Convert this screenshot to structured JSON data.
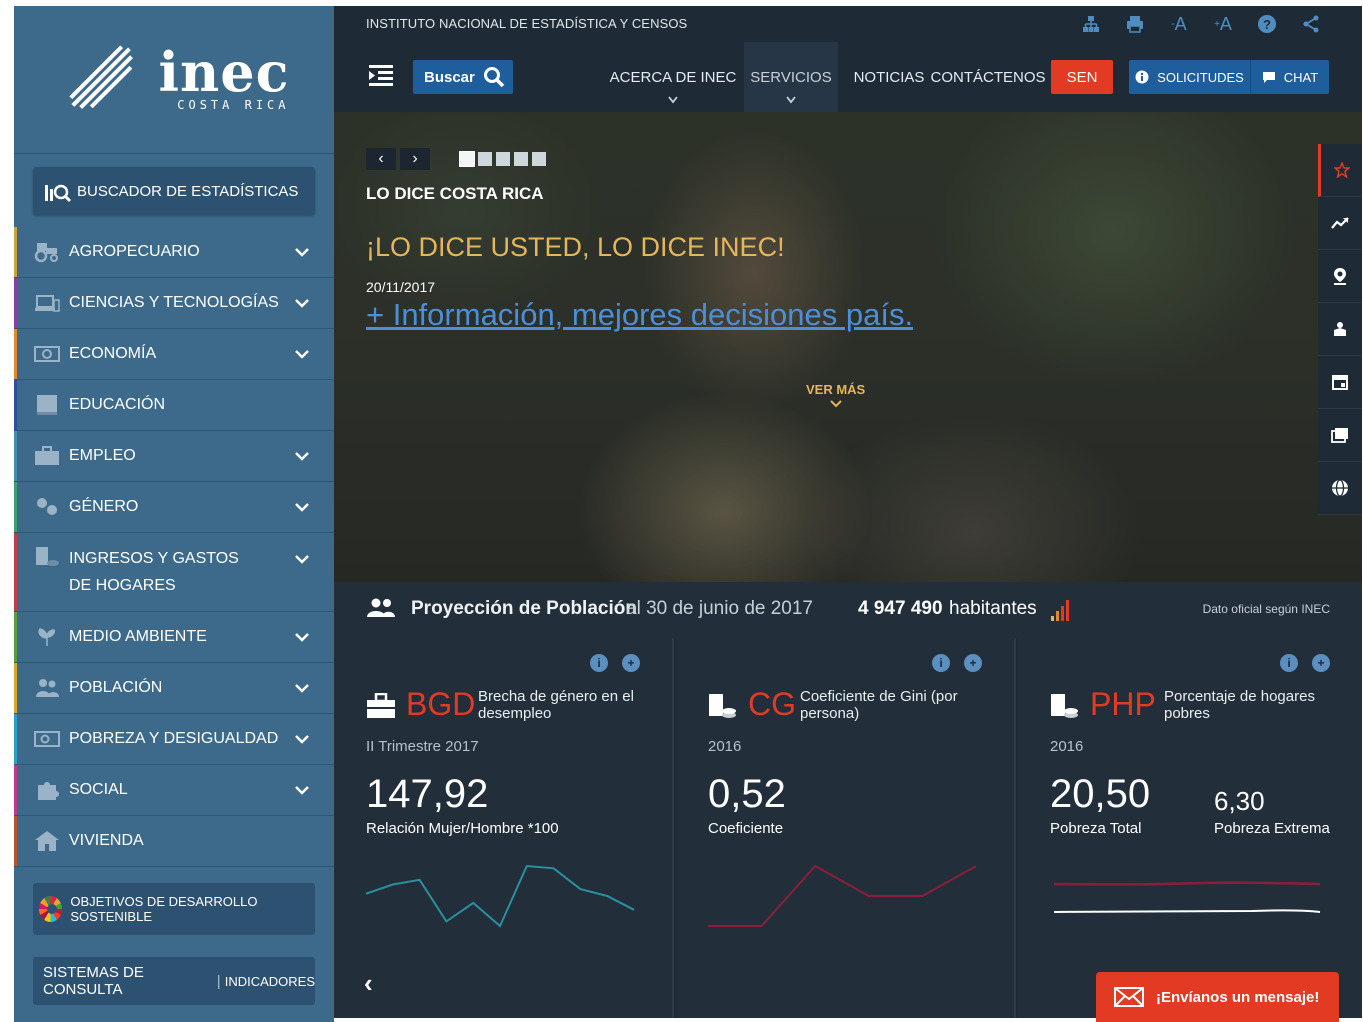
{
  "brand": {
    "logo_text": "inec",
    "logo_sub": "COSTA RICA"
  },
  "sidebar": {
    "search_stats_label": "BUSCADOR DE ESTADÍSTICAS",
    "items": [
      {
        "label": "AGROPECUARIO",
        "icon": "tractor-icon",
        "color": "#c8a43a",
        "has_sub": true
      },
      {
        "label": "CIENCIAS Y TECNOLOGÍAS",
        "icon": "laptop-icon",
        "color": "#8a3fa0",
        "has_sub": true
      },
      {
        "label": "ECONOMÍA",
        "icon": "money-icon",
        "color": "#e08a2c",
        "has_sub": true
      },
      {
        "label": "EDUCACIÓN",
        "icon": "book-icon",
        "color": "#2f4f9c",
        "has_sub": false
      },
      {
        "label": "EMPLEO",
        "icon": "briefcase-icon",
        "color": "#3f8fb0",
        "has_sub": true
      },
      {
        "label": "GÉNERO",
        "icon": "gender-icon",
        "color": "#3a9f72",
        "has_sub": true
      },
      {
        "label_line1": "INGRESOS Y GASTOS",
        "label_line2": "DE HOGARES",
        "icon": "coins-icon",
        "color": "#c03a4a",
        "has_sub": true
      },
      {
        "label": "MEDIO AMBIENTE",
        "icon": "plant-icon",
        "color": "#5aa03a",
        "has_sub": true
      },
      {
        "label": "POBLACIÓN",
        "icon": "people-icon",
        "color": "#d9a62a",
        "has_sub": true
      },
      {
        "label": "POBREZA Y DESIGUALDAD",
        "icon": "wallet-icon",
        "color": "#2aa0c8",
        "has_sub": true
      },
      {
        "label": "SOCIAL",
        "icon": "puzzle-icon",
        "color": "#c03a8a",
        "has_sub": true
      },
      {
        "label": "VIVIENDA",
        "icon": "house-icon",
        "color": "#b3562a",
        "has_sub": false
      }
    ],
    "ods_label": "OBJETIVOS DE DESARROLLO SOSTENIBLE",
    "sistemas_label": "SISTEMAS DE CONSULTA",
    "indicadores_label": "INDICADORES"
  },
  "header": {
    "institute": "INSTITUTO NACIONAL DE ESTADÍSTICA Y CENSOS",
    "font_decrease": "A",
    "font_increase": "A",
    "search_label": "Buscar",
    "nav": [
      {
        "label": "ACERCA DE INEC",
        "has_sub": true
      },
      {
        "label": "SERVICIOS",
        "has_sub": true
      },
      {
        "label": "NOTICIAS",
        "has_sub": false
      },
      {
        "label": "CONTÁCTENOS",
        "has_sub": false
      }
    ],
    "sen_label": "SEN",
    "solicitudes_label": "SOLICITUDES",
    "chat_label": "CHAT"
  },
  "hero": {
    "kicker": "LO DICE COSTA RICA",
    "title": "¡LO DICE USTED, LO DICE INEC!",
    "date": "20/11/2017",
    "link": "+ Información, mejores decisiones país.",
    "ver_mas": "VER MÁS",
    "slides_total": 5,
    "active_slide": 1
  },
  "population": {
    "title": "Proyección de Población",
    "date_text": "al 30 de junio de 2017",
    "value": "4 947 490",
    "unit": "habitantes",
    "note": "Dato oficial según INEC"
  },
  "cards": [
    {
      "abbr": "BGD",
      "name": "Brecha de género en el desempleo",
      "period": "II Trimestre 2017",
      "value": "147,92",
      "label": "Relación Mujer/Hombre *100",
      "series_color": "#2a8fa0",
      "series": [
        3.0,
        3.4,
        3.6,
        1.8,
        2.6,
        1.6,
        4.2,
        4.1,
        3.2,
        2.9,
        2.3
      ]
    },
    {
      "abbr": "CG",
      "name": "Coeficiente de Gini (por persona)",
      "period": "2016",
      "value": "0,52",
      "label": "Coeficiente",
      "series_color": "#8a1f3a",
      "series": [
        0.5,
        0.5,
        0.52,
        0.51,
        0.51,
        0.52
      ]
    },
    {
      "abbr": "PHP",
      "name": "Porcentaje de hogares pobres",
      "period": "2016",
      "value": "20,50",
      "label": "Pobreza Total",
      "value2": "6,30",
      "label2": "Pobreza Extrema",
      "series_color": "#8a1f3a",
      "series2_color": "#ffffff"
    }
  ],
  "chat_message": "¡Envíanos un mensaje!",
  "colors": {
    "accent_red": "#e23a23",
    "primary_blue": "#1f5e9c",
    "sidebar_blue": "#3d6a8a",
    "gold": "#e5b65c"
  }
}
